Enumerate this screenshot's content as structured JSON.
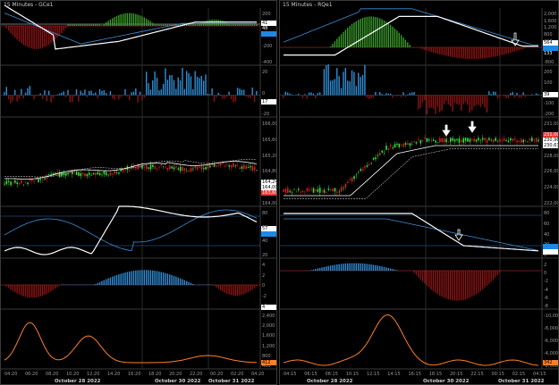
{
  "left": {
    "title": "15 Minutes - GCe1",
    "panel1": {
      "tags": [
        {
          "text": "41",
          "bg": "#ffffff",
          "fg": "#000000"
        },
        {
          "text": "48",
          "bg": "#000000",
          "fg": "#ffffff"
        },
        {
          "text": "",
          "bg": "#1e88e5",
          "fg": "#ffffff"
        }
      ],
      "ticks": [
        "200",
        "0",
        "-200",
        "-400"
      ]
    },
    "panel2": {
      "tags": [
        {
          "text": "17",
          "bg": "#ffffff",
          "fg": "#000000"
        }
      ],
      "ticks": [
        "20",
        "0",
        "-20"
      ]
    },
    "panel3": {
      "tags": [
        {
          "text": "164,246",
          "bg": "#ffffff",
          "fg": "#000000"
        },
        {
          "text": "164,000",
          "bg": "#ffffff",
          "fg": "#000000"
        },
        {
          "text": "163,600",
          "bg": "#e53935",
          "fg": "#ffffff"
        }
      ],
      "ticks": [
        "166,000",
        "165,600",
        "165,200",
        "164,800",
        "164,400",
        "164,000"
      ]
    },
    "panel4": {
      "tags": [
        {
          "text": "57",
          "bg": "#ffffff",
          "fg": "#000000"
        },
        {
          "text": "",
          "bg": "#1e88e5",
          "fg": "#ffffff"
        }
      ],
      "ticks": [
        "80",
        "60",
        "40",
        "20"
      ]
    },
    "panel5": {
      "tags": [
        {
          "text": "4",
          "bg": "#ffffff",
          "fg": "#000000"
        }
      ],
      "ticks": [
        "4",
        "2",
        "0",
        "-2",
        "-4"
      ]
    },
    "panel6": {
      "tags": [
        {
          "text": "412",
          "bg": "#ff7f27",
          "fg": "#000000"
        }
      ],
      "ticks": [
        "2,400",
        "2,000",
        "1,600",
        "1,200",
        "800",
        "400"
      ]
    },
    "x_ticks": [
      "04:20",
      "06:20",
      "08:20",
      "10:20",
      "12:20",
      "14:20",
      "16:20",
      "18:20",
      "20:20",
      "22:20",
      "00:20",
      "02:20",
      "04:20"
    ],
    "dates": [
      "October 28 2022",
      "October 30 2022",
      "October 31 2022"
    ]
  },
  "right": {
    "title": "15 Minutes - RQe1",
    "panel1": {
      "tags": [
        {
          "text": "564",
          "bg": "#ffffff",
          "fg": "#000000"
        },
        {
          "text": "",
          "bg": "#1e88e5",
          "fg": "#ffffff"
        },
        {
          "text": "133",
          "bg": "#000000",
          "fg": "#ffffff"
        }
      ],
      "ticks": [
        "2,000",
        "1,600",
        "1,200",
        "800",
        "400",
        "0",
        "-400",
        "-800"
      ]
    },
    "panel2": {
      "tags": [
        {
          "text": "39",
          "bg": "#ffffff",
          "fg": "#000000"
        }
      ],
      "ticks": [
        "200",
        "100",
        "0",
        "-100",
        "-200"
      ]
    },
    "panel3": {
      "tags": [
        {
          "text": "231,000",
          "bg": "#e53935",
          "fg": "#ffffff"
        },
        {
          "text": "230,966",
          "bg": "#ffffff",
          "fg": "#000000"
        },
        {
          "text": "230,635",
          "bg": "#ffffff",
          "fg": "#000000"
        }
      ],
      "ticks": [
        "231,000",
        "230,000",
        "228,000",
        "226,000",
        "224,000",
        "222,000"
      ]
    },
    "panel4": {
      "tags": [
        {
          "text": "",
          "bg": "#1e88e5",
          "fg": "#ffffff"
        },
        {
          "text": "",
          "bg": "#ffffff",
          "fg": "#000000"
        }
      ],
      "ticks": [
        "80",
        "60",
        "40",
        "20",
        "0"
      ]
    },
    "panel5": {
      "tags": [],
      "ticks": [
        "2",
        "0",
        "-2",
        "-4",
        "-6",
        "-8"
      ]
    },
    "panel6": {
      "tags": [
        {
          "text": "342",
          "bg": "#ff7f27",
          "fg": "#000000"
        }
      ],
      "ticks": [
        "-10,000",
        "-8,000",
        "-6,000",
        "-4,000",
        "-2,000"
      ]
    },
    "x_ticks": [
      "04:15",
      "06:15",
      "08:15",
      "10:15",
      "12:15",
      "14:15",
      "16:15",
      "18:15",
      "20:15",
      "22:15",
      "00:15",
      "02:15",
      "04:15"
    ],
    "dates": [
      "October 28 2022",
      "October 30 2022",
      "October 31 2022"
    ]
  },
  "colors": {
    "background": "#000000",
    "up": "#3ddc3d",
    "down": "#cc2222",
    "histogram_up": "#3a9e2a",
    "histogram_down": "#8e1414",
    "volume_up": "#2f8fd8",
    "signal": "#ffffff",
    "slow": "#3b8fd8",
    "orange": "#ff7f27"
  }
}
